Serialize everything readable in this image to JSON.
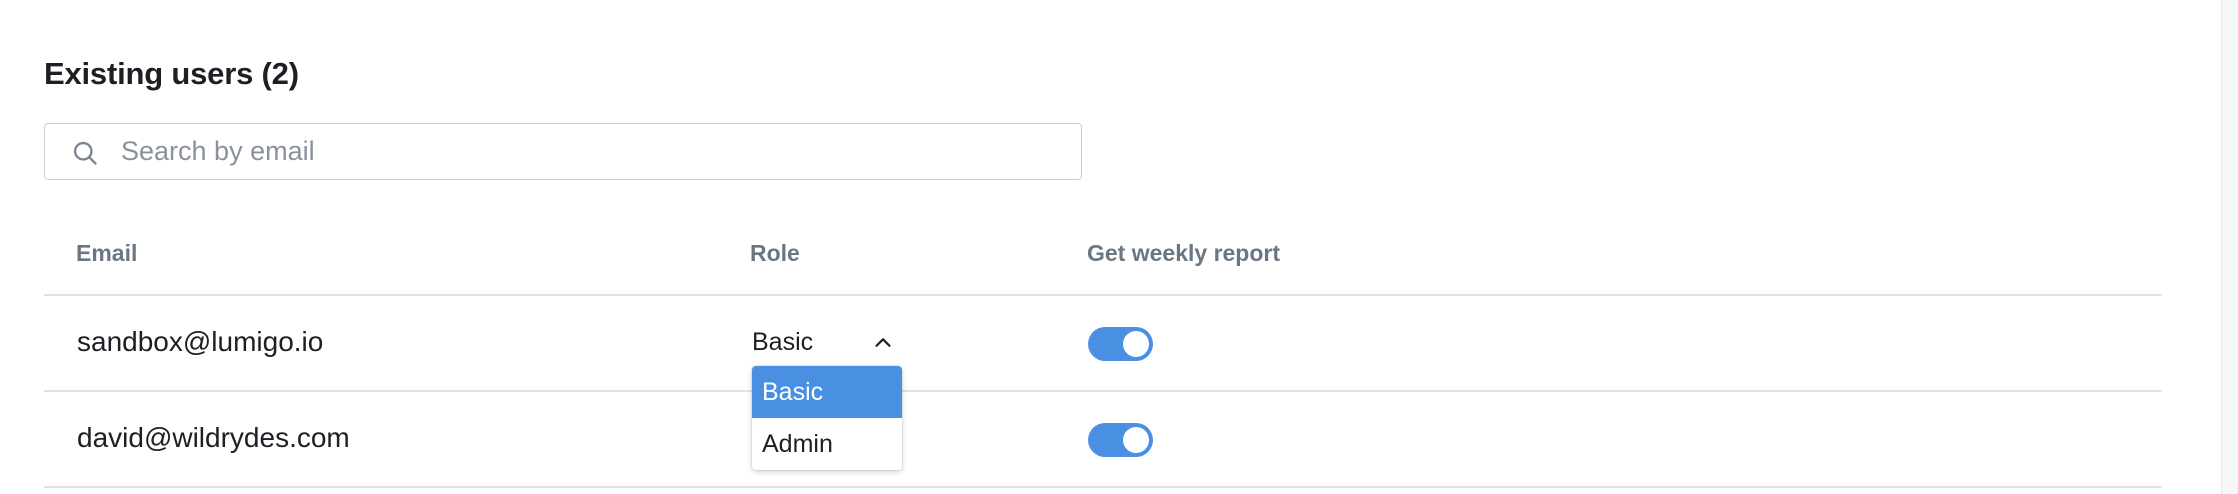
{
  "section": {
    "title": "Existing users (2)"
  },
  "search": {
    "placeholder": "Search by email",
    "value": "",
    "icon": "search-icon"
  },
  "table": {
    "columns": {
      "email": "Email",
      "role": "Role",
      "report": "Get weekly report"
    },
    "rows": [
      {
        "email": "sandbox@lumigo.io",
        "role": "Basic",
        "weekly_report": true
      },
      {
        "email": "david@wildrydes.com",
        "role": "",
        "weekly_report": true
      }
    ]
  },
  "role_dropdown": {
    "open_for_row": 0,
    "options": [
      "Basic",
      "Admin"
    ],
    "selected": "Basic"
  },
  "colors": {
    "accent": "#4a90e2",
    "header_text": "#6b7683",
    "divider": "#e1e3e7"
  }
}
